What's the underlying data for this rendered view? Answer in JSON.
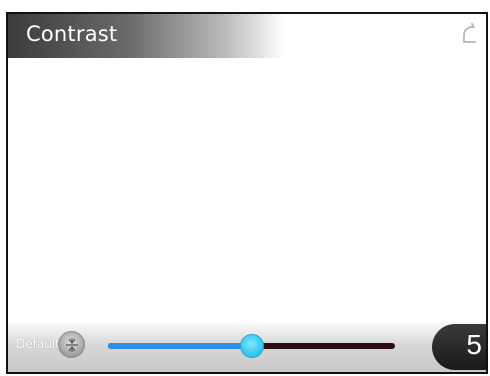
{
  "header": {
    "title": "Contrast",
    "back_icon": "back-arrow-icon"
  },
  "footer": {
    "default_label": "Default",
    "default_icon": "reset-default-icon",
    "slider": {
      "value_fraction": 0.5,
      "track_color": "#2b0f14",
      "fill_color": "#2f8fe8",
      "thumb_color": "#3ccaf2"
    },
    "value": "5"
  }
}
